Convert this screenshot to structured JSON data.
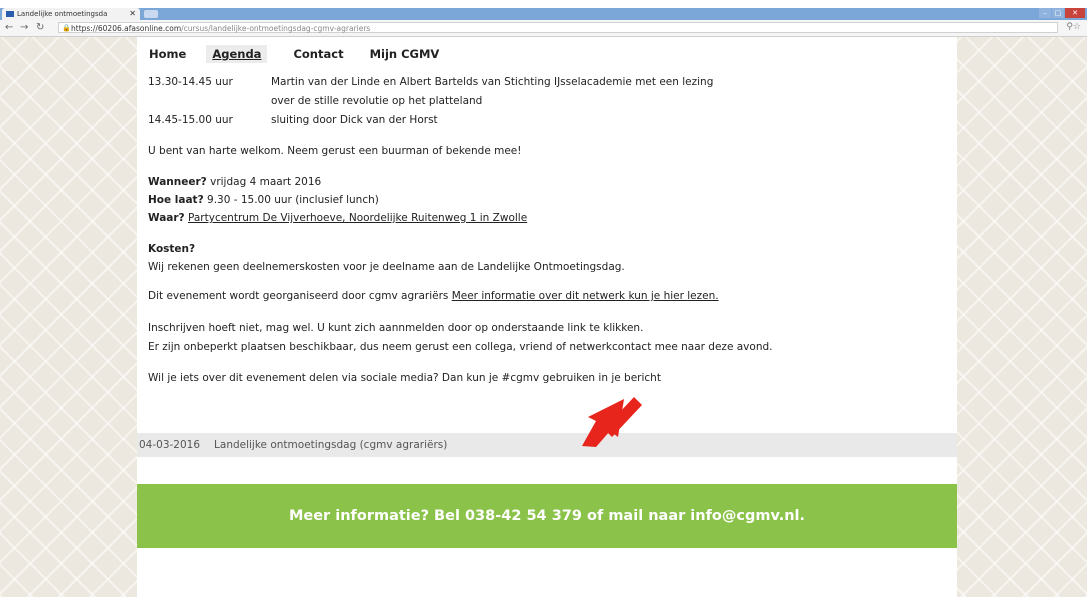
{
  "browser": {
    "tab_title": "Landelijke ontmoetingsda",
    "url_domain": "https://60206.afasonline.com",
    "url_path": "/cursus/landelijke-ontmoetingsdag-cgmv-agrariers"
  },
  "nav": [
    "Home",
    "Agenda",
    "Contact",
    "Mijn CGMV"
  ],
  "schedule": [
    {
      "time": "13.30-14.45 uur",
      "line1": "Martin van der Linde en Albert Bartelds van Stichting IJsselacademie met een lezing",
      "line2": "over de stille revolutie op het platteland"
    },
    {
      "time": "14.45-15.00 uur",
      "line1": "sluiting door Dick van der Horst"
    }
  ],
  "welcome": "U bent van harte welkom. Neem gerust een buurman of bekende mee!",
  "when_label": "Wanneer?",
  "when_value": " vrijdag 4 maart 2016",
  "time_label": "Hoe laat?",
  "time_value": " 9.30 - 15.00 uur (inclusief lunch)",
  "where_label": "Waar?",
  "where_value": "Partycentrum De Vijverhoeve, Noordelijke Ruitenweg 1 in Zwolle",
  "costs_label": "Kosten?",
  "costs_text": "Wij rekenen geen deelnemerskosten voor je deelname aan de Landelijke Ontmoetingsdag.",
  "organised_text": "Dit evenement wordt georganiseerd door cgmv agrariërs ",
  "organised_link": "Meer informatie over dit netwerk kun je hier lezen.",
  "signup_line1": "Inschrijven hoeft niet, mag wel. U kunt zich aannmelden door op onderstaande link te klikken.",
  "signup_line2": "Er zijn onbeperkt plaatsen beschikbaar, dus neem gerust een collega, vriend of netwerkcontact mee naar deze avond.",
  "social_text": "Wil je iets over dit evenement delen via sociale media? Dan kun je #cgmv gebruiken in je bericht",
  "event_date": "04-03-2016",
  "event_title": "Landelijke ontmoetingsdag (cgmv agrariërs)",
  "footer_banner": "Meer informatie? Bel 038-42 54 379 of mail naar info@cgmv.nl.",
  "colors": {
    "banner": "#8bc34a",
    "arrow": "#e8251c"
  }
}
